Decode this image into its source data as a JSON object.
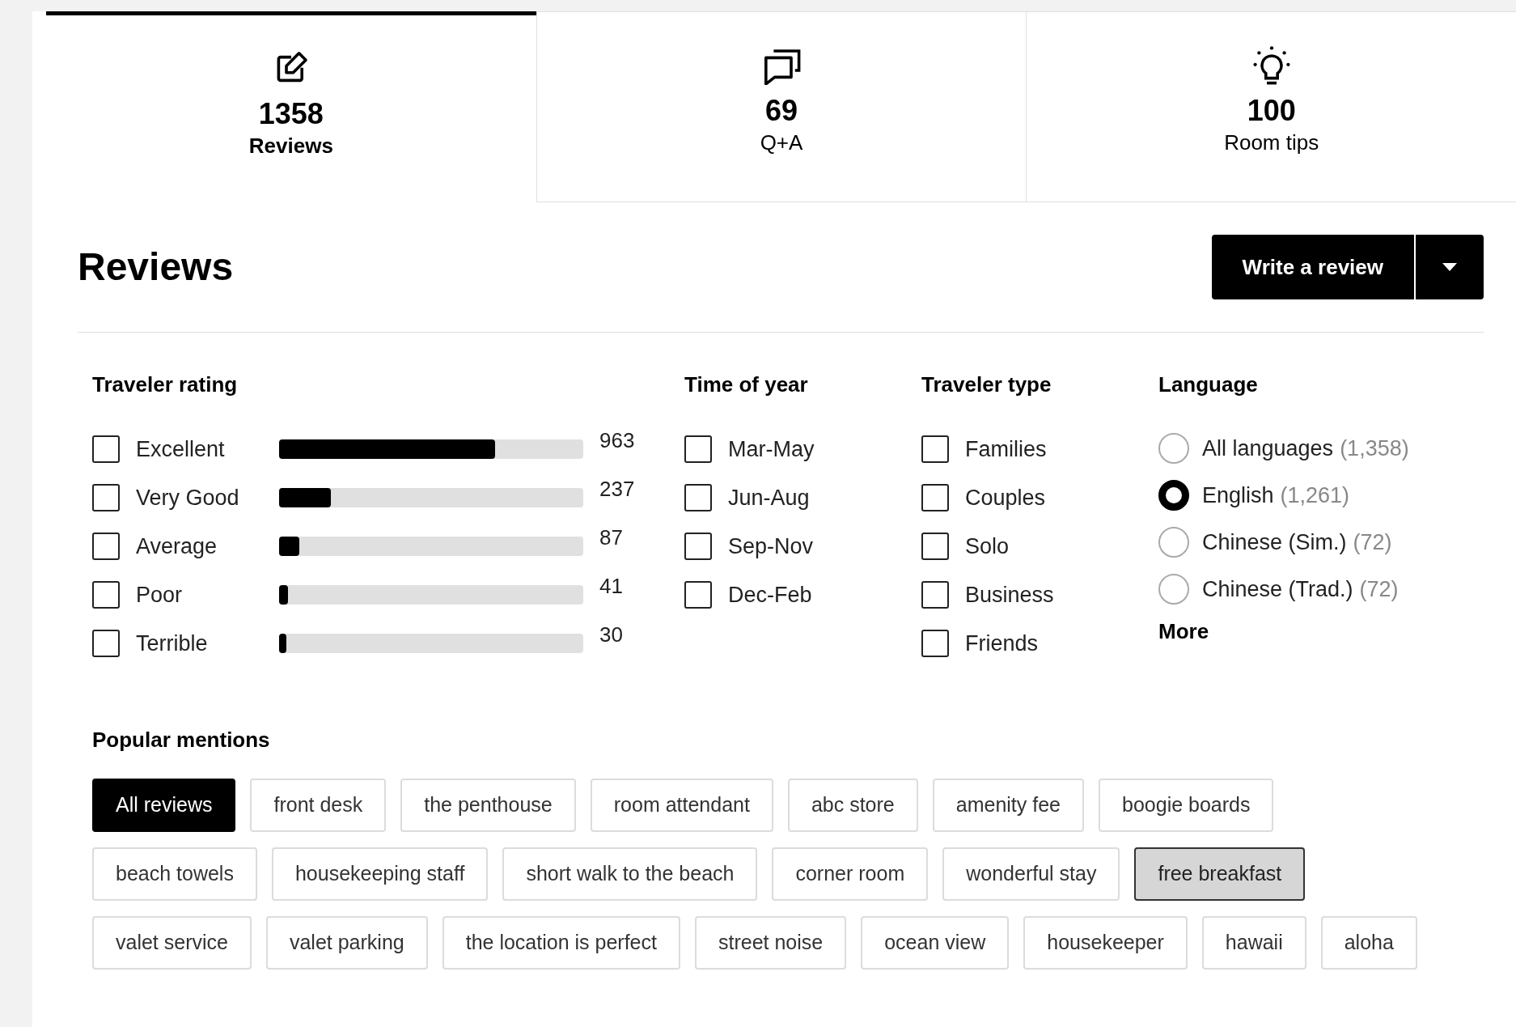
{
  "tabs": [
    {
      "kind": "edit",
      "count": "1358",
      "label": "Reviews",
      "selected": true
    },
    {
      "kind": "chat",
      "count": "69",
      "label": "Q+A",
      "selected": false
    },
    {
      "kind": "bulb",
      "count": "100",
      "label": "Room tips",
      "selected": false
    }
  ],
  "heading": "Reviews",
  "write_button": {
    "label": "Write a review"
  },
  "filters": {
    "traveler_rating": {
      "title": "Traveler rating",
      "items": [
        {
          "label": "Excellent",
          "checked": false,
          "level": 0.71,
          "count": "963"
        },
        {
          "label": "Very Good",
          "checked": false,
          "level": 0.17,
          "count": "237"
        },
        {
          "label": "Average",
          "checked": false,
          "level": 0.067,
          "count": "87"
        },
        {
          "label": "Poor",
          "checked": false,
          "level": 0.03,
          "count": "41"
        },
        {
          "label": "Terrible",
          "checked": false,
          "level": 0.025,
          "count": "30"
        }
      ]
    },
    "time_of_year": {
      "title": "Time of year",
      "items": [
        {
          "label": "Mar-May",
          "checked": false
        },
        {
          "label": "Jun-Aug",
          "checked": false
        },
        {
          "label": "Sep-Nov",
          "checked": false
        },
        {
          "label": "Dec-Feb",
          "checked": false
        }
      ]
    },
    "traveler_type": {
      "title": "Traveler type",
      "items": [
        {
          "label": "Families",
          "checked": false
        },
        {
          "label": "Couples",
          "checked": false
        },
        {
          "label": "Solo",
          "checked": false
        },
        {
          "label": "Business",
          "checked": false
        },
        {
          "label": "Friends",
          "checked": false
        }
      ]
    },
    "language": {
      "title": "Language",
      "items": [
        {
          "label": "All languages",
          "count": "(1,358)",
          "selected": false
        },
        {
          "label": "English",
          "count": "(1,261)",
          "selected": true
        },
        {
          "label": "Chinese (Sim.)",
          "count": "(72)",
          "selected": false
        },
        {
          "label": "Chinese (Trad.)",
          "count": "(72)",
          "selected": false
        }
      ],
      "more": "More"
    }
  },
  "popular_mentions": {
    "title": "Popular mentions",
    "rows": [
      {
        "chips": [
          {
            "label": "All reviews",
            "selected": true,
            "hovered": false
          },
          {
            "label": "front desk",
            "selected": false,
            "hovered": false
          },
          {
            "label": "the penthouse",
            "selected": false,
            "hovered": false
          },
          {
            "label": "room attendant",
            "selected": false,
            "hovered": false
          },
          {
            "label": "abc store",
            "selected": false,
            "hovered": false
          },
          {
            "label": "amenity fee",
            "selected": false,
            "hovered": false
          },
          {
            "label": "boogie boards",
            "selected": false,
            "hovered": false
          }
        ]
      },
      {
        "chips": [
          {
            "label": "beach towels",
            "selected": false,
            "hovered": false
          },
          {
            "label": "housekeeping staff",
            "selected": false,
            "hovered": false
          },
          {
            "label": "short walk to the beach",
            "selected": false,
            "hovered": false
          },
          {
            "label": "corner room",
            "selected": false,
            "hovered": false
          },
          {
            "label": "wonderful stay",
            "selected": false,
            "hovered": false
          },
          {
            "label": "free breakfast",
            "selected": false,
            "hovered": true
          }
        ]
      },
      {
        "chips": [
          {
            "label": "valet service",
            "selected": false,
            "hovered": false
          },
          {
            "label": "valet parking",
            "selected": false,
            "hovered": false
          },
          {
            "label": "the location is perfect",
            "selected": false,
            "hovered": false
          },
          {
            "label": "street noise",
            "selected": false,
            "hovered": false
          },
          {
            "label": "ocean view",
            "selected": false,
            "hovered": false
          },
          {
            "label": "housekeeper",
            "selected": false,
            "hovered": false
          },
          {
            "label": "hawaii",
            "selected": false,
            "hovered": false
          },
          {
            "label": "aloha",
            "selected": false,
            "hovered": false
          }
        ]
      }
    ]
  }
}
